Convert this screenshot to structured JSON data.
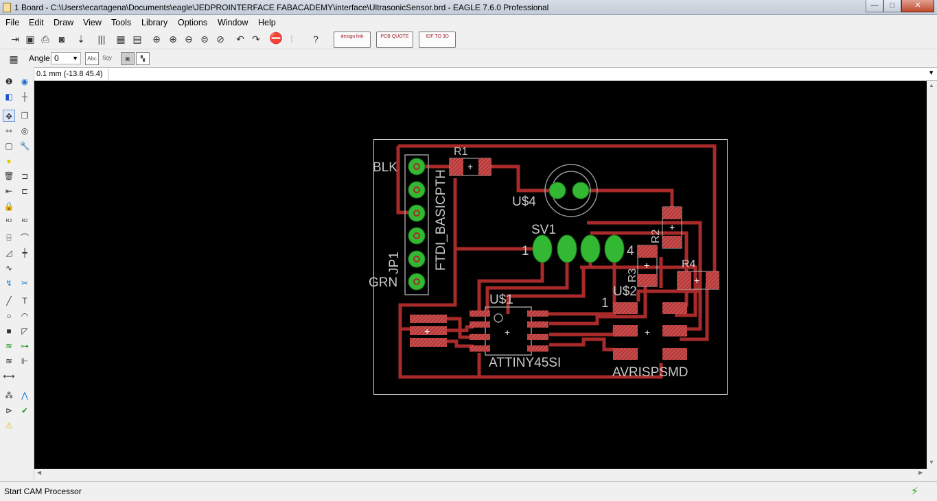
{
  "window": {
    "title": "1 Board - C:\\Users\\ecartagena\\Documents\\eagle\\JEDPROINTERFACE FABACADEMY\\interface\\UltrasonicSensor.brd - EAGLE 7.6.0 Professional",
    "minimize": "—",
    "maximize": "□",
    "close": "✕"
  },
  "menu": [
    "File",
    "Edit",
    "Draw",
    "View",
    "Tools",
    "Library",
    "Options",
    "Window",
    "Help"
  ],
  "toolbar": {
    "design_link": "design link",
    "pcb_quote": "PCB QUOTE",
    "idf_3d": "IDF TO 3D"
  },
  "params": {
    "angle_label": "Angle:",
    "angle_value": "0",
    "abc": "Abc",
    "sqy": "Sqy"
  },
  "command": {
    "coordinates": "0.1 mm (-13.8 45.4)",
    "input_value": ""
  },
  "board": {
    "labels": {
      "blk": "BLK",
      "grn": "GRN",
      "jp1": "JP1",
      "ftdi": "FTDI_BASICPTH",
      "r1": "R1",
      "u4": "U$4",
      "sv1": "SV1",
      "sv1_pin1": "1",
      "sv1_pin4": "4",
      "r2": "R2",
      "r3": "R3",
      "r4": "R4",
      "u1": "U$1",
      "attiny": "ATTINY45SI",
      "u2": "U$2",
      "u2_pin1": "1",
      "avrisp": "AVRISPSMD"
    }
  },
  "status": {
    "text": "Start CAM Processor"
  }
}
